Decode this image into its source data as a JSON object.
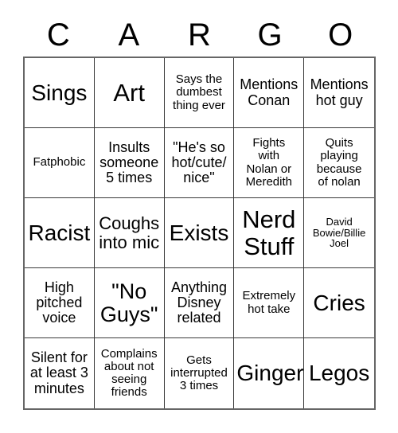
{
  "card": {
    "header_letters": [
      "C",
      "A",
      "R",
      "G",
      "O"
    ],
    "rows": [
      [
        {
          "text": "Sings",
          "size": "lg"
        },
        {
          "text": "Art",
          "size": "xl"
        },
        {
          "text": "Says the\ndumbest\nthing ever",
          "size": "xs"
        },
        {
          "text": "Mentions\nConan",
          "size": "sm"
        },
        {
          "text": "Mentions\nhot guy",
          "size": "sm"
        }
      ],
      [
        {
          "text": "Fatphobic",
          "size": "xs"
        },
        {
          "text": "Insults\nsomeone\n5 times",
          "size": "sm"
        },
        {
          "text": "\"He's so\nhot/cute/\nnice\"",
          "size": "sm"
        },
        {
          "text": "Fights\nwith\nNolan or\nMeredith",
          "size": "xs"
        },
        {
          "text": "Quits\nplaying\nbecause\nof nolan",
          "size": "xs"
        }
      ],
      [
        {
          "text": "Racist",
          "size": "lg"
        },
        {
          "text": "Coughs\ninto mic",
          "size": "md"
        },
        {
          "text": "Exists",
          "size": "lg"
        },
        {
          "text": "Nerd\nStuff",
          "size": "xl"
        },
        {
          "text": "David\nBowie/Billie\nJoel",
          "size": "xxs"
        }
      ],
      [
        {
          "text": "High\npitched\nvoice",
          "size": "sm"
        },
        {
          "text": "\"No\nGuys\"",
          "size": "lg2"
        },
        {
          "text": "Anything\nDisney\nrelated",
          "size": "sm"
        },
        {
          "text": "Extremely\nhot take",
          "size": "xs"
        },
        {
          "text": "Cries",
          "size": "lg"
        }
      ],
      [
        {
          "text": "Silent for\nat least 3\nminutes",
          "size": "sm"
        },
        {
          "text": "Complains\nabout not\nseeing\nfriends",
          "size": "xs"
        },
        {
          "text": "Gets\ninterrupted\n3 times",
          "size": "xs"
        },
        {
          "text": "Ginger",
          "size": "lg"
        },
        {
          "text": "Legos",
          "size": "lg"
        }
      ]
    ]
  },
  "colors": {
    "background": "#ffffff",
    "text": "#000000",
    "grid_line": "#3a3a3a",
    "outer_border": "#666666"
  }
}
